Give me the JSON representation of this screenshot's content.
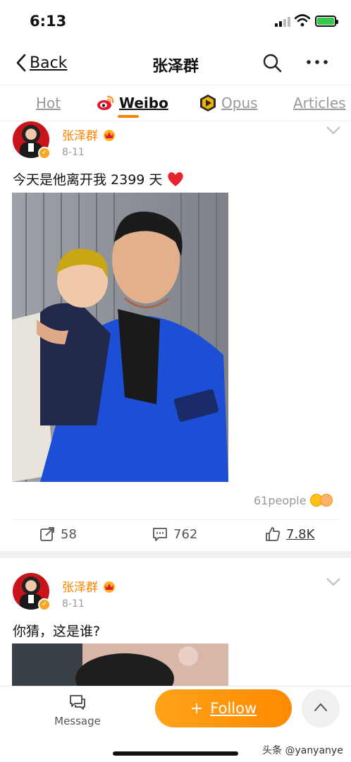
{
  "status_bar": {
    "time": "6:13"
  },
  "nav": {
    "back_label": "Back",
    "title": "张泽群"
  },
  "tabs": [
    {
      "label": "Hot",
      "active": false
    },
    {
      "label": "Weibo",
      "active": true
    },
    {
      "label": "Opus",
      "active": false
    },
    {
      "label": "Articles",
      "active": false
    }
  ],
  "posts": [
    {
      "author": "张泽群",
      "date": "8-11",
      "text": "今天是他离开我 2399 天",
      "reactions_summary": "61people",
      "reposts": "58",
      "comments": "762",
      "likes": "7.8K"
    },
    {
      "author": "张泽群",
      "date": "8-11",
      "text": "你猜，这是谁?"
    }
  ],
  "bottom_bar": {
    "message_label": "Message",
    "follow_label": "Follow",
    "follow_plus": "+"
  },
  "watermark": "头条 @yanyanye",
  "colors": {
    "accent": "#ff8200",
    "follow_gradient_start": "#ffa31a",
    "follow_gradient_end": "#ff8a00",
    "author_name": "#ff8200",
    "muted": "#999999"
  }
}
